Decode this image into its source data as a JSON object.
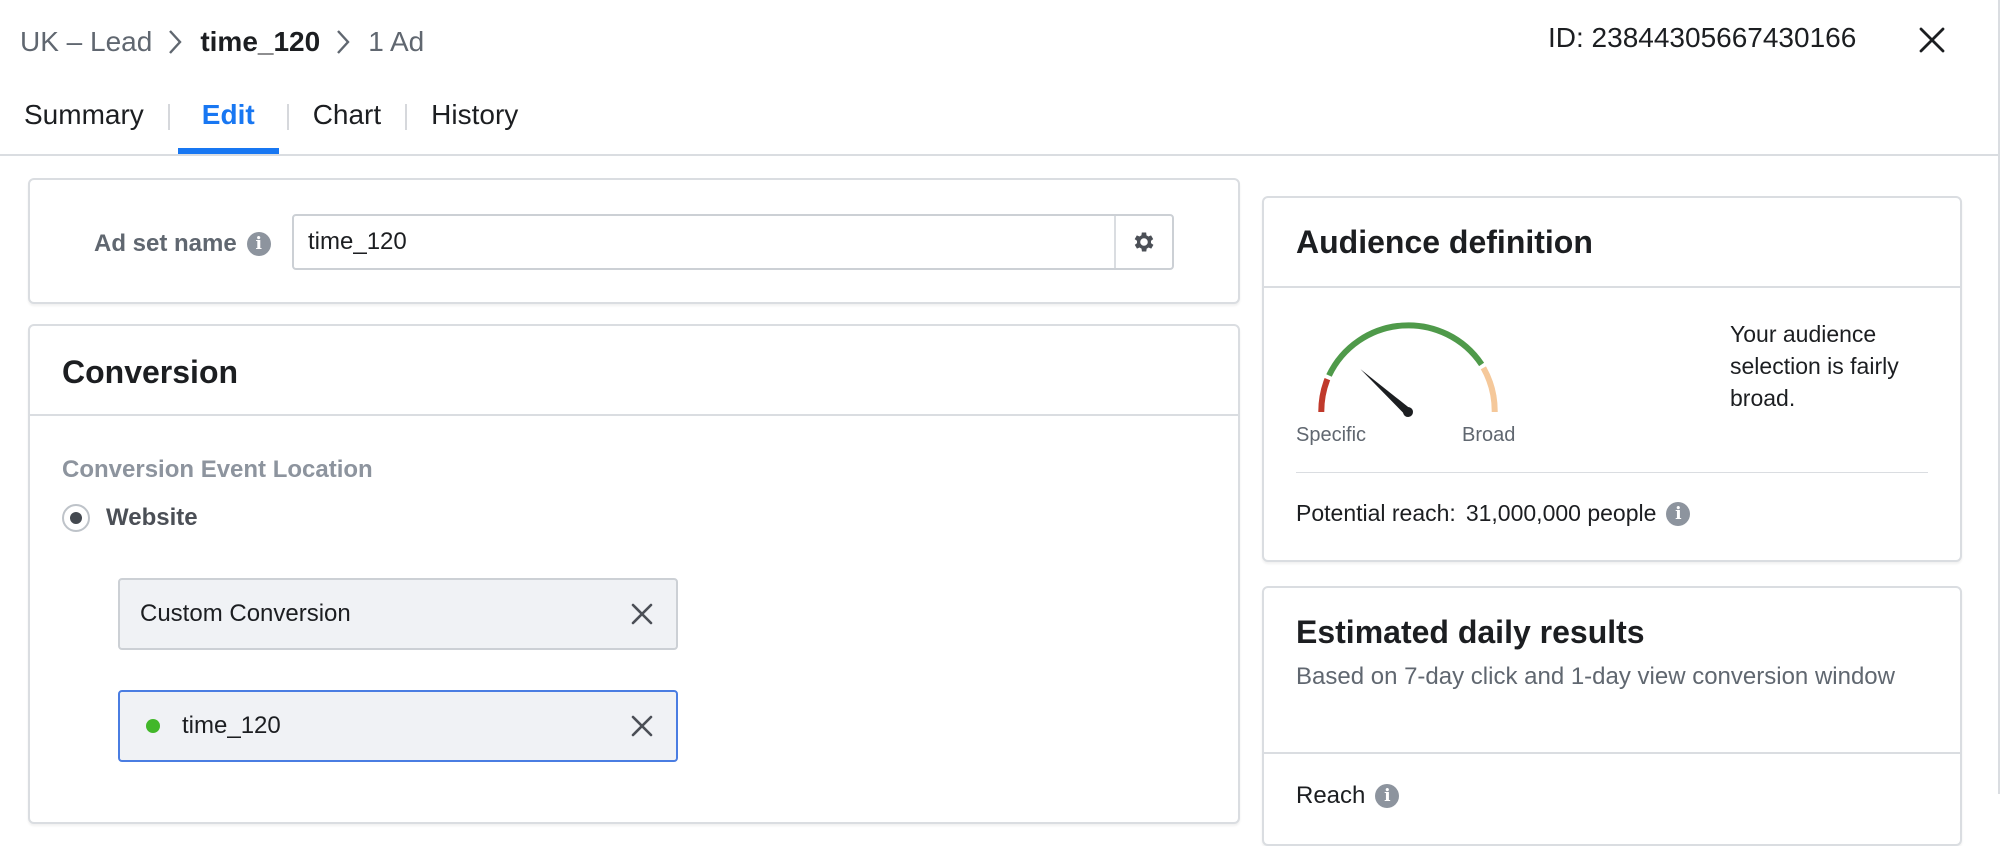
{
  "breadcrumb": {
    "campaign": "UK – Lead",
    "adset": "time_120",
    "ads": "1 Ad"
  },
  "header": {
    "id_text": "ID: 23844305667430166"
  },
  "tabs": [
    {
      "label": "Summary",
      "active": false
    },
    {
      "label": "Edit",
      "active": true
    },
    {
      "label": "Chart",
      "active": false
    },
    {
      "label": "History",
      "active": false
    }
  ],
  "adset": {
    "label": "Ad set name",
    "value": "time_120"
  },
  "conversion": {
    "title": "Conversion",
    "location_label": "Conversion Event Location",
    "radio_label": "Website",
    "chips": [
      {
        "label": "Custom Conversion"
      },
      {
        "label": "time_120"
      }
    ]
  },
  "audience": {
    "title": "Audience definition",
    "gauge_left": "Specific",
    "gauge_right": "Broad",
    "description": "Your audience selection is fairly broad.",
    "reach_label": "Potential reach:",
    "reach_value": "31,000,000 people"
  },
  "estimated": {
    "title": "Estimated daily results",
    "subtitle": "Based on 7-day click and 1-day view conversion window",
    "reach_label": "Reach"
  },
  "colors": {
    "accent": "#1877f2",
    "gauge_red": "#c0392b",
    "gauge_green": "#4f9a4a",
    "gauge_orange": "#f5c89a",
    "status_green": "#42b72a"
  }
}
